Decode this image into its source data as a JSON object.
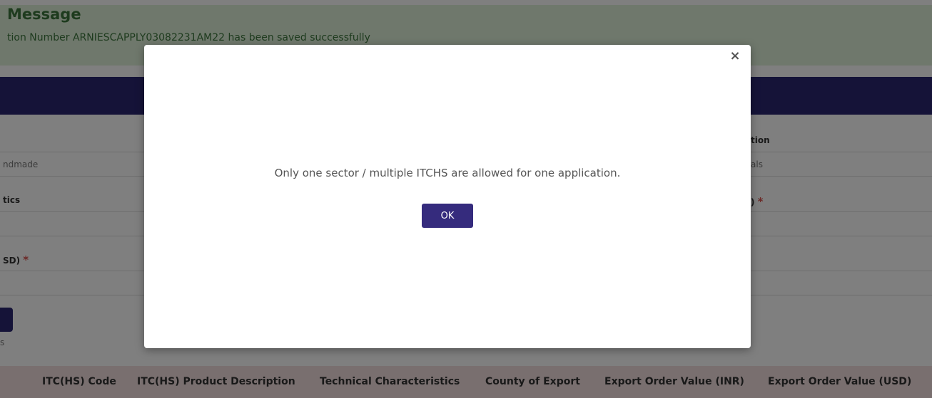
{
  "banner": {
    "title": "Message",
    "text": "tion Number ARNIESCAPPLY03082231AM22 has been saved successfully"
  },
  "form": {
    "left_value_1": "ndmade",
    "left_label_2": "tics",
    "left_label_3": "SD)",
    "right_label_1": "tion",
    "right_value_1": "als",
    "right_label_2": ")",
    "required_mark": "*",
    "small_text": "s"
  },
  "table": {
    "headers": [
      "ITC(HS) Code",
      "ITC(HS) Product Description",
      "Technical Characteristics",
      "County of Export",
      "Export Order Value (INR)",
      "Export Order Value (USD)"
    ]
  },
  "modal": {
    "close_glyph": "×",
    "message": "Only one sector / multiple ITCHS are allowed for one application.",
    "ok_label": "OK"
  }
}
